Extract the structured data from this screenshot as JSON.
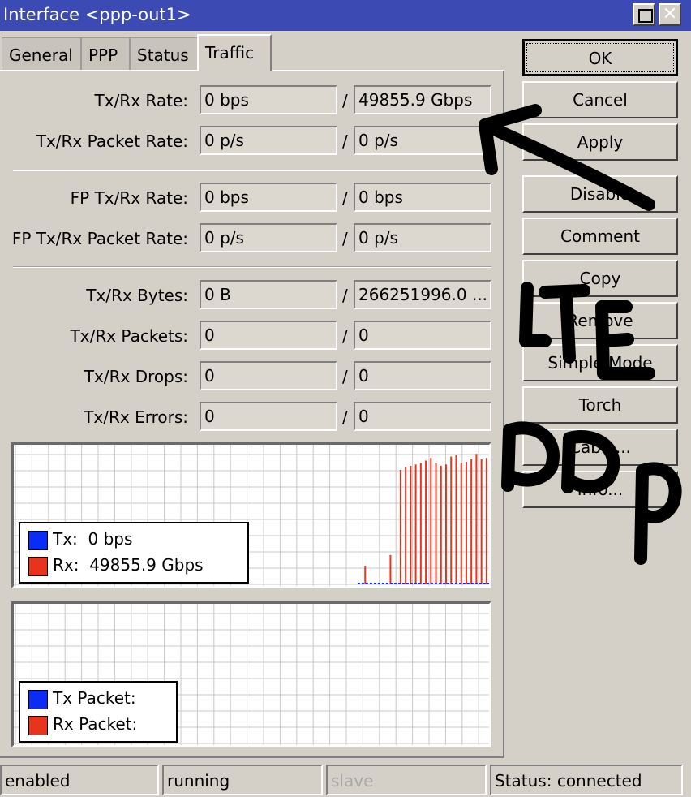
{
  "window": {
    "title": "Interface <ppp-out1>"
  },
  "tabs": [
    {
      "label": "General"
    },
    {
      "label": "PPP"
    },
    {
      "label": "Status"
    },
    {
      "label": "Traffic",
      "active": true
    }
  ],
  "traffic": {
    "rows": [
      {
        "label": "Tx/Rx Rate:",
        "tx": "0 bps",
        "rx": "49855.9 Gbps"
      },
      {
        "label": "Tx/Rx Packet Rate:",
        "tx": "0 p/s",
        "rx": "0 p/s"
      },
      {
        "label": "FP Tx/Rx Rate:",
        "tx": "0 bps",
        "rx": "0 bps"
      },
      {
        "label": "FP Tx/Rx Packet Rate:",
        "tx": "0 p/s",
        "rx": "0 p/s"
      },
      {
        "label": "Tx/Rx Bytes:",
        "tx": "0 B",
        "rx": "266251996.0 ..."
      },
      {
        "label": "Tx/Rx Packets:",
        "tx": "0",
        "rx": "0"
      },
      {
        "label": "Tx/Rx Drops:",
        "tx": "0",
        "rx": "0"
      },
      {
        "label": "Tx/Rx Errors:",
        "tx": "0",
        "rx": "0"
      }
    ],
    "separator": "/"
  },
  "rate_graph": {
    "legend": {
      "tx_label": "Tx:",
      "tx_value": "0 bps",
      "rx_label": "Rx:",
      "rx_value": "49855.9 Gbps"
    },
    "colors": {
      "tx": "#0a2cf5",
      "rx": "#e8341c",
      "grid": "#c8c8c8"
    }
  },
  "packet_graph": {
    "legend": {
      "tx_label": "Tx Packet:",
      "rx_label": "Rx Packet:"
    }
  },
  "chart_data": {
    "type": "bar",
    "series": [
      {
        "name": "Rx",
        "values": [
          0,
          0,
          0,
          0,
          0,
          0,
          0,
          0,
          0,
          0,
          0,
          0,
          0,
          0,
          0,
          0,
          0,
          0,
          0,
          0,
          0,
          0,
          0,
          0,
          0,
          0,
          0,
          0,
          0,
          0,
          0,
          0,
          0,
          0,
          0,
          0,
          0,
          0,
          0,
          0,
          0,
          0,
          0,
          0,
          0,
          0,
          0,
          0,
          0,
          0,
          0,
          0,
          0,
          0,
          0,
          0,
          0,
          0,
          0,
          0,
          0,
          0,
          0,
          0,
          0,
          0,
          0,
          0,
          0,
          0.14,
          0,
          0,
          0,
          0,
          0.22,
          0,
          0.86,
          0.88,
          0.89,
          0.9,
          0.91,
          0.93,
          0.95,
          0.91,
          0.89,
          0.9,
          0.96,
          0.97,
          0.91,
          0.92,
          0.94,
          0.98,
          0.94,
          0.95
        ]
      },
      {
        "name": "Tx",
        "values": []
      }
    ]
  },
  "buttons": [
    {
      "label": "OK"
    },
    {
      "label": "Cancel"
    },
    {
      "label": "Apply"
    },
    {
      "label": "Disable"
    },
    {
      "label": "Comment"
    },
    {
      "label": "Copy"
    },
    {
      "label": "Remove"
    },
    {
      "label": "Simple Mode"
    },
    {
      "label": "Torch"
    },
    {
      "label": "Cable..."
    },
    {
      "label": "Info..."
    }
  ],
  "statusbar": {
    "enabled": "enabled",
    "running": "running",
    "slave": "slave",
    "status": "Status: connected"
  },
  "annotation": {
    "text_line1": "LTE",
    "text_line2": "PPP",
    "color": "#000000"
  }
}
